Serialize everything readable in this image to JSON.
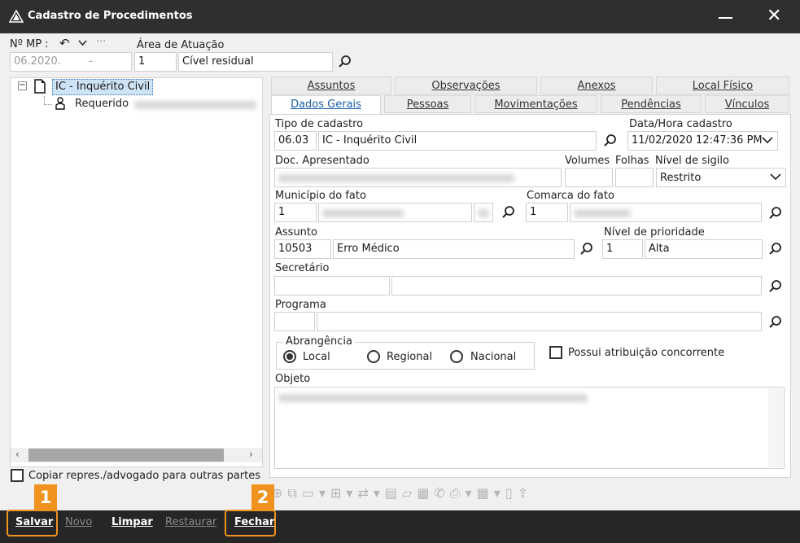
{
  "window": {
    "title": "Cadastro de Procedimentos"
  },
  "header": {
    "mp_label": "Nº MP :",
    "mp_value": "06.2020.",
    "mp_dash": "-",
    "area_label": "Área de Atuação",
    "area_code": "1",
    "area_name": "Cível residual"
  },
  "tree": {
    "root": "IC - Inquérito Civil",
    "child": "Requerido",
    "copy_label": "Copiar repres./advogado para outras partes"
  },
  "tabs": {
    "row1": [
      "Assuntos",
      "Observações",
      "Anexos",
      "Local Físico"
    ],
    "row2": [
      "Dados Gerais",
      "Pessoas",
      "Movimentações",
      "Pendências",
      "Vínculos"
    ]
  },
  "form": {
    "tipo_label": "Tipo de cadastro",
    "tipo_code": "06.03",
    "tipo_name": "IC - Inquérito Civil",
    "data_label": "Data/Hora cadastro",
    "data_value": "11/02/2020 12:47:36 PM",
    "doc_label": "Doc. Apresentado",
    "volumes_label": "Volumes",
    "folhas_label": "Folhas",
    "sigilo_label": "Nível de sigilo",
    "sigilo_value": "Restrito",
    "municipio_label": "Município do fato",
    "municipio_code": "1",
    "comarca_label": "Comarca do fato",
    "comarca_code": "1",
    "assunto_label": "Assunto",
    "assunto_code": "10503",
    "assunto_name": "Erro Médico",
    "prioridade_label": "Nível de prioridade",
    "prioridade_code": "1",
    "prioridade_name": "Alta",
    "secretario_label": "Secretário",
    "programa_label": "Programa",
    "abrangencia_label": "Abrangência",
    "abrangencia_options": [
      "Local",
      "Regional",
      "Nacional"
    ],
    "abrangencia_selected": "Local",
    "concorrente_label": "Possui atribuição concorrente",
    "objeto_label": "Objeto"
  },
  "bottom": {
    "salvar": "Salvar",
    "novo": "Novo",
    "limpar": "Limpar",
    "restaurar": "Restaurar",
    "fechar": "Fechar"
  },
  "callouts": {
    "one": "1",
    "two": "2"
  },
  "colors": {
    "accent": "#f0931e",
    "titlebar": "#2f2f2f",
    "bottombar": "#262626"
  }
}
